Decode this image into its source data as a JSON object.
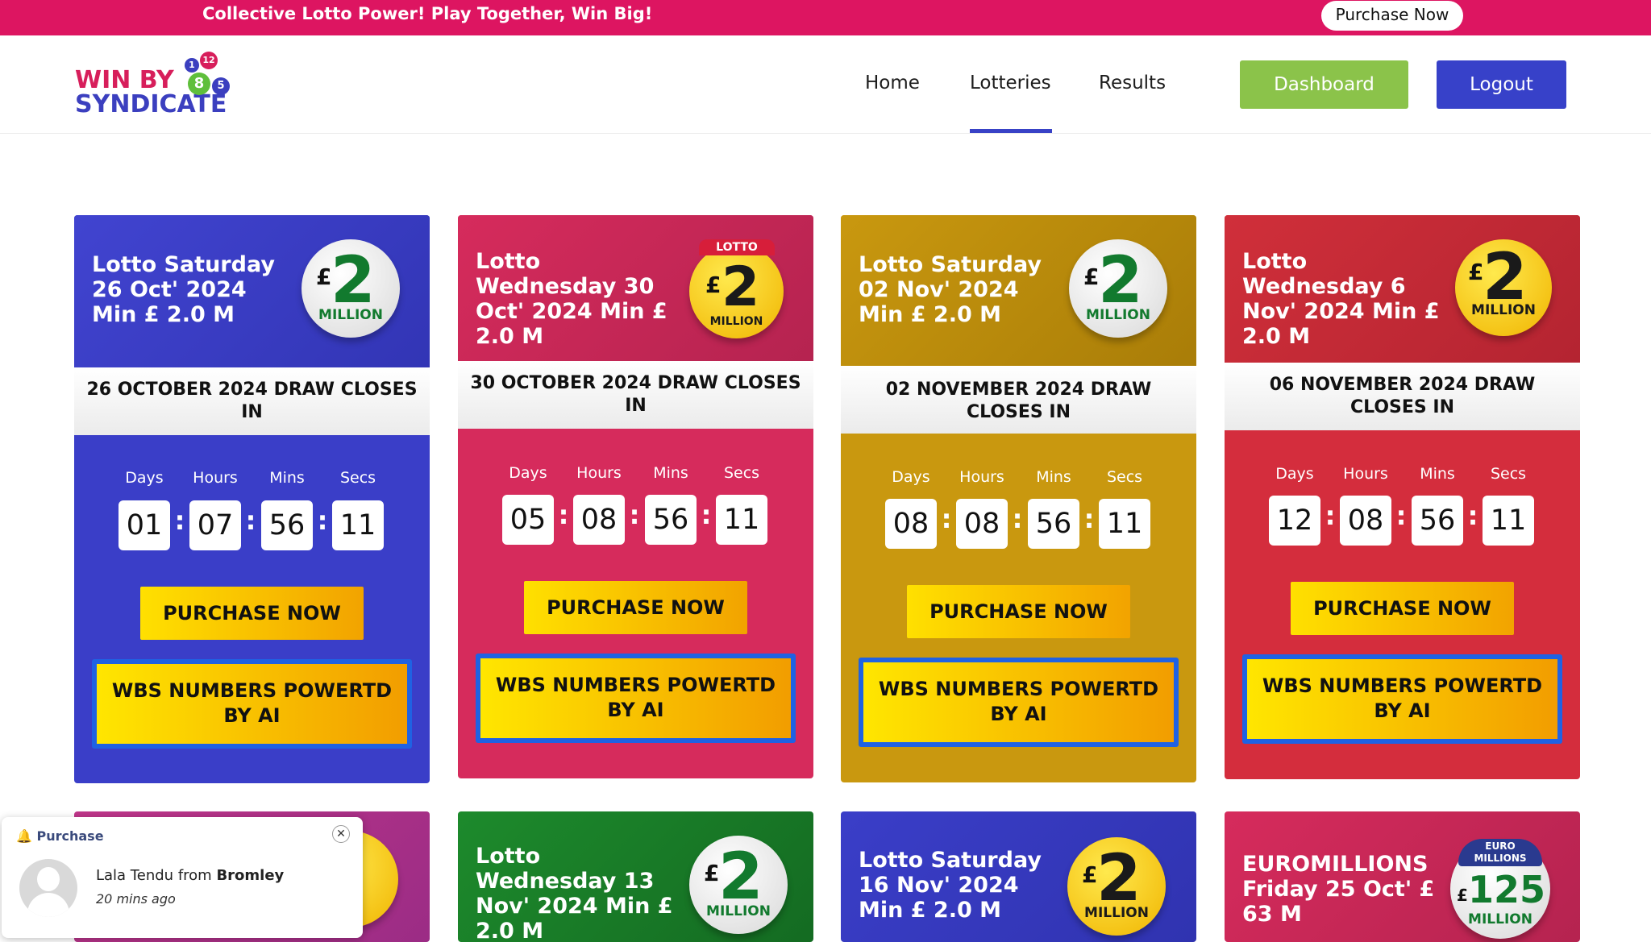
{
  "topbar": {
    "promo": "Collective Lotto Power! Play Together, Win Big!",
    "button": "Purchase Now"
  },
  "brand": {
    "line1": "WIN BY",
    "line2": "SYNDICATE",
    "balls": [
      "1",
      "12",
      "8",
      "5"
    ]
  },
  "nav": {
    "items": [
      "Home",
      "Lotteries",
      "Results"
    ],
    "active": "Lotteries",
    "dashboard": "Dashboard",
    "logout": "Logout"
  },
  "countdown_labels": [
    "Days",
    "Hours",
    "Mins",
    "Secs"
  ],
  "cards": [
    {
      "title": "Lotto Saturday 26 Oct' 2024 Min £ 2.0 M",
      "jackpot": "2",
      "jackpot_unit": "MILLION",
      "closes": "26 OCTOBER 2024 DRAW CLOSES IN",
      "days": "01",
      "hours": "07",
      "mins": "56",
      "secs": "11",
      "purchase": "PURCHASE NOW",
      "wbs": "WBS NUMBERS POWERTD BY AI",
      "color": "#3a3ec8"
    },
    {
      "title": "Lotto Wednesday 30 Oct' 2024 Min £ 2.0 M",
      "jackpot_tag": "LOTTO",
      "jackpot": "2",
      "jackpot_unit": "MILLION",
      "closes": "30 OCTOBER 2024 DRAW CLOSES IN",
      "days": "05",
      "hours": "08",
      "mins": "56",
      "secs": "11",
      "purchase": "PURCHASE NOW",
      "wbs": "WBS NUMBERS POWERTD BY AI",
      "color": "#d62b5c"
    },
    {
      "title": "Lotto Saturday 02 Nov' 2024 Min £ 2.0 M",
      "jackpot": "2",
      "jackpot_unit": "MILLION",
      "closes": "02 NOVEMBER 2024 DRAW CLOSES IN",
      "days": "08",
      "hours": "08",
      "mins": "56",
      "secs": "11",
      "purchase": "PURCHASE NOW",
      "wbs": "WBS NUMBERS POWERTD BY AI",
      "color": "#c9980f"
    },
    {
      "title": "Lotto Wednesday 6 Nov' 2024 Min £ 2.0 M",
      "jackpot": "2",
      "jackpot_unit": "MILLION",
      "closes": "06 NOVEMBER 2024 DRAW CLOSES IN",
      "days": "12",
      "hours": "08",
      "mins": "56",
      "secs": "11",
      "purchase": "PURCHASE NOW",
      "wbs": "WBS NUMBERS POWERTD BY AI",
      "color": "#d42d3d"
    }
  ],
  "cards_row2": [
    {
      "title": "",
      "color": "#b3378e"
    },
    {
      "title": "Lotto Wednesday 13 Nov' 2024 Min £ 2.0 M",
      "jackpot": "2",
      "jackpot_unit": "MILLION",
      "color": "#1d8a2c"
    },
    {
      "title": "Lotto Saturday 16 Nov' 2024 Min £ 2.0 M",
      "jackpot": "2",
      "jackpot_unit": "MILLION",
      "color": "#3a3ec8"
    },
    {
      "title": "EUROMILLIONS Friday 25 Oct' £ 63 M",
      "jackpot_tag": "EURO MILLIONS",
      "jackpot": "125",
      "jackpot_unit": "MILLION",
      "color": "#d62b5c"
    }
  ],
  "notification": {
    "label": "Purchase",
    "name": "Lala Tendu",
    "from": "from",
    "place": "Bromley",
    "time": "20 mins ago"
  }
}
